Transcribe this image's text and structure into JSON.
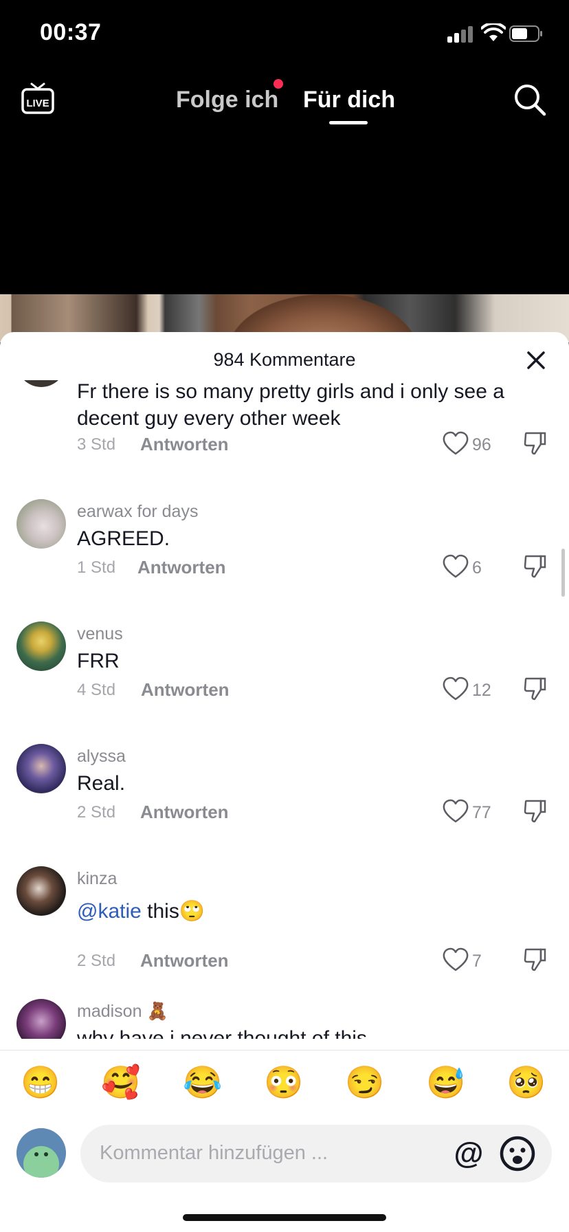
{
  "status_bar": {
    "time": "00:37"
  },
  "top_nav": {
    "live_label": "LIVE",
    "tabs": [
      {
        "label": "Folge ich"
      },
      {
        "label": "Für dich"
      }
    ],
    "active_tab": "Für dich"
  },
  "comments_panel": {
    "title": "984 Kommentare",
    "reply_label": "Antworten",
    "comments": [
      {
        "username": "",
        "text": "Fr there is so many pretty girls and i only see a decent guy every other week",
        "time": "3 Std",
        "likes": "96"
      },
      {
        "username": "earwax  for  days",
        "text": "AGREED.",
        "time": "1 Std",
        "likes": "6"
      },
      {
        "username": "venus",
        "text": "FRR",
        "time": "4 Std",
        "likes": "12"
      },
      {
        "username": "alyssa",
        "text": "Real.",
        "time": "2 Std",
        "likes": "77"
      },
      {
        "username": "kinza",
        "mention": "@katie",
        "text": " this🙄",
        "time": "2 Std",
        "likes": "7"
      },
      {
        "username": "madison 🧸",
        "text": "why have i never thought of this",
        "time": "",
        "likes": ""
      }
    ]
  },
  "emoji_bar": [
    "😁",
    "🥰",
    "😂",
    "😳",
    "😏",
    "😅",
    "🥺"
  ],
  "composer": {
    "placeholder": "Kommentar hinzufügen ...",
    "mention_symbol": "@"
  },
  "colors": {
    "accent_dot": "#fe2c55",
    "mention": "#2b5db9",
    "text": "#161823",
    "muted": "#8a8b91"
  }
}
